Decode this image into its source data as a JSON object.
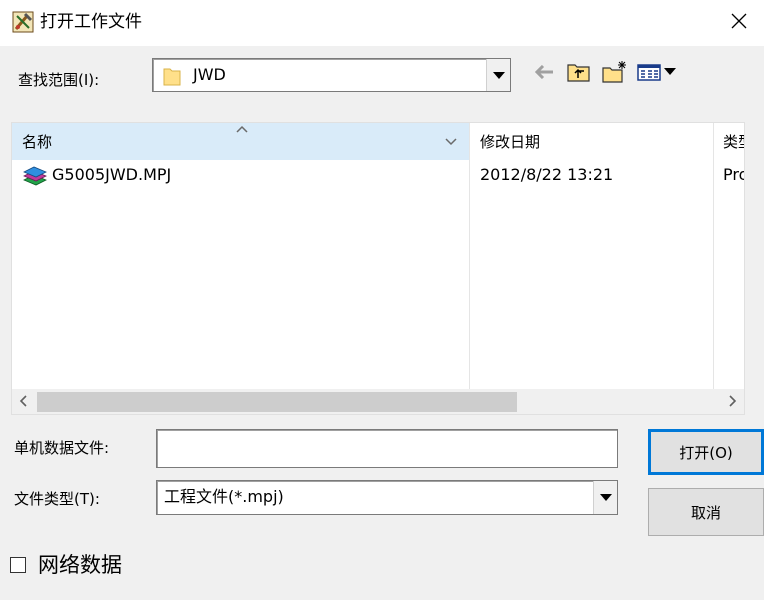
{
  "window": {
    "title": "打开工作文件",
    "close_icon": "close-icon"
  },
  "lookin": {
    "label": "查找范围(I):",
    "value": "JWD",
    "icon": "folder-icon"
  },
  "toolbar": {
    "back_icon": "back-arrow-icon",
    "up_icon": "up-folder-icon",
    "new_folder_icon": "new-folder-icon",
    "view_icon": "view-menu-icon"
  },
  "filelist": {
    "columns": [
      "名称",
      "修改日期",
      "类型"
    ],
    "rows": [
      {
        "name": "G5005JWD.MPJ",
        "date": "2012/8/22 13:21",
        "type": "Pro",
        "icon": "project-file-icon"
      }
    ]
  },
  "filename": {
    "label": "单机数据文件:",
    "value": ""
  },
  "filetype": {
    "label": "文件类型(T):",
    "value": "工程文件(*.mpj)"
  },
  "buttons": {
    "open": "打开(O)",
    "cancel": "取消"
  },
  "network": {
    "label": "网络数据",
    "checked": false
  },
  "colors": {
    "selected_header": "#d9ebf9",
    "focus_border": "#0078d7"
  }
}
